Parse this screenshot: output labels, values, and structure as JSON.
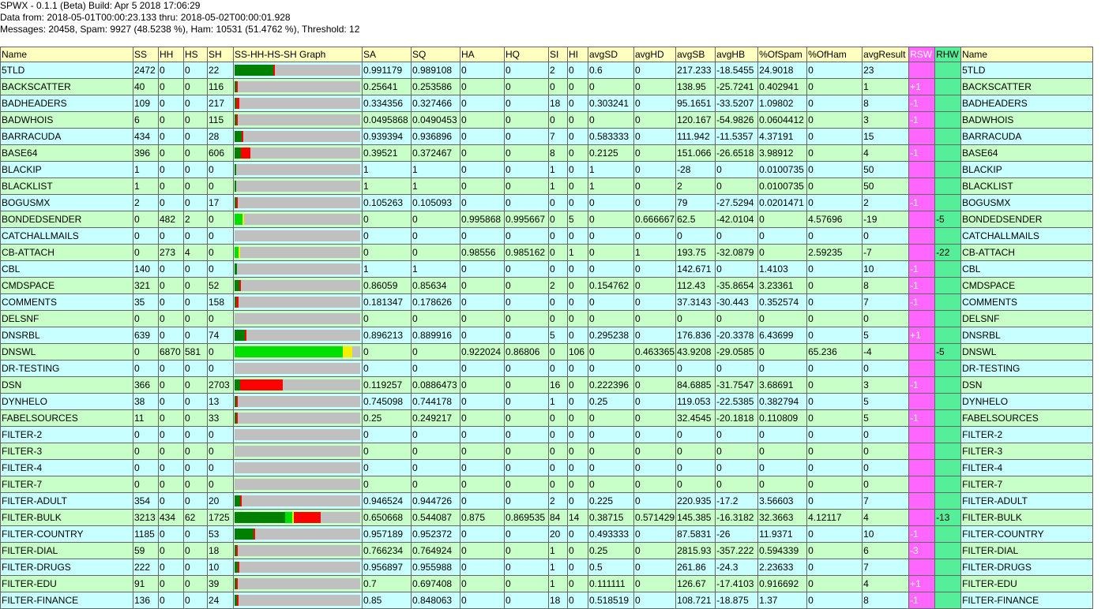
{
  "header": {
    "line1": "SPWX - 0.1.1 (Beta) Build: Apr 5 2018 17:06:29",
    "line2": "Data from: 2018-05-01T00:00:23.133 thru: 2018-05-02T00:00:01.928",
    "line3": "Messages: 20458, Spam: 9927 (48.5238 %), Ham: 10531 (51.4762 %), Threshold: 12"
  },
  "columns": [
    "Name",
    "SS",
    "HH",
    "HS",
    "SH",
    "SS-HH-HS-SH Graph",
    "SA",
    "SQ",
    "HA",
    "HQ",
    "SI",
    "HI",
    "avgSD",
    "avgHD",
    "avgSB",
    "avgHB",
    "%OfSpam",
    "%OfHam",
    "avgResult",
    "RSW",
    "RHW",
    "Name"
  ],
  "colors": {
    "ss": "#008000",
    "hh": "#00e000",
    "hs": "#f0f000",
    "sh": "#ff0000",
    "bar_bg": "#c0c0c0",
    "row_a": "#c8ffff",
    "row_b": "#c8ffc8",
    "rsw": "#ff66ff",
    "rhw": "#55ee99"
  },
  "graph_scale_total": 8000,
  "rows": [
    {
      "name": "5TLD",
      "ss": "2472",
      "hh": "0",
      "hs": "0",
      "sh": "22",
      "sa": "0.991179",
      "sq": "0.989108",
      "ha": "0",
      "hq": "0",
      "si": "2",
      "hi": "0",
      "avgsd": "0.6",
      "avghd": "0",
      "avgsb": "217.233",
      "avghb": "-18.5455",
      "pspam": "24.9018",
      "pham": "0",
      "avgres": "23",
      "rsw": "",
      "rhw": ""
    },
    {
      "name": "BACKSCATTER",
      "ss": "40",
      "hh": "0",
      "hs": "0",
      "sh": "116",
      "sa": "0.25641",
      "sq": "0.253586",
      "ha": "0",
      "hq": "0",
      "si": "0",
      "hi": "0",
      "avgsd": "0",
      "avghd": "0",
      "avgsb": "138.95",
      "avghb": "-25.7241",
      "pspam": "0.402941",
      "pham": "0",
      "avgres": "1",
      "rsw": "+1",
      "rhw": ""
    },
    {
      "name": "BADHEADERS",
      "ss": "109",
      "hh": "0",
      "hs": "0",
      "sh": "217",
      "sa": "0.334356",
      "sq": "0.327466",
      "ha": "0",
      "hq": "0",
      "si": "18",
      "hi": "0",
      "avgsd": "0.303241",
      "avghd": "0",
      "avgsb": "95.1651",
      "avghb": "-33.5207",
      "pspam": "1.09802",
      "pham": "0",
      "avgres": "8",
      "rsw": "-1",
      "rhw": ""
    },
    {
      "name": "BADWHOIS",
      "ss": "6",
      "hh": "0",
      "hs": "0",
      "sh": "115",
      "sa": "0.0495868",
      "sq": "0.0490453",
      "ha": "0",
      "hq": "0",
      "si": "0",
      "hi": "0",
      "avgsd": "0",
      "avghd": "0",
      "avgsb": "120.167",
      "avghb": "-54.9826",
      "pspam": "0.0604412",
      "pham": "0",
      "avgres": "3",
      "rsw": "-1",
      "rhw": ""
    },
    {
      "name": "BARRACUDA",
      "ss": "434",
      "hh": "0",
      "hs": "0",
      "sh": "28",
      "sa": "0.939394",
      "sq": "0.936896",
      "ha": "0",
      "hq": "0",
      "si": "7",
      "hi": "0",
      "avgsd": "0.583333",
      "avghd": "0",
      "avgsb": "111.942",
      "avghb": "-11.5357",
      "pspam": "4.37191",
      "pham": "0",
      "avgres": "15",
      "rsw": "",
      "rhw": ""
    },
    {
      "name": "BASE64",
      "ss": "396",
      "hh": "0",
      "hs": "0",
      "sh": "606",
      "sa": "0.39521",
      "sq": "0.372467",
      "ha": "0",
      "hq": "0",
      "si": "8",
      "hi": "0",
      "avgsd": "0.2125",
      "avghd": "0",
      "avgsb": "151.066",
      "avghb": "-26.6518",
      "pspam": "3.98912",
      "pham": "0",
      "avgres": "4",
      "rsw": "-1",
      "rhw": ""
    },
    {
      "name": "BLACKIP",
      "ss": "1",
      "hh": "0",
      "hs": "0",
      "sh": "0",
      "sa": "1",
      "sq": "1",
      "ha": "0",
      "hq": "0",
      "si": "1",
      "hi": "0",
      "avgsd": "1",
      "avghd": "0",
      "avgsb": "-28",
      "avghb": "0",
      "pspam": "0.0100735",
      "pham": "0",
      "avgres": "50",
      "rsw": "",
      "rhw": ""
    },
    {
      "name": "BLACKLIST",
      "ss": "1",
      "hh": "0",
      "hs": "0",
      "sh": "0",
      "sa": "1",
      "sq": "1",
      "ha": "0",
      "hq": "0",
      "si": "1",
      "hi": "0",
      "avgsd": "1",
      "avghd": "0",
      "avgsb": "2",
      "avghb": "0",
      "pspam": "0.0100735",
      "pham": "0",
      "avgres": "50",
      "rsw": "",
      "rhw": ""
    },
    {
      "name": "BOGUSMX",
      "ss": "2",
      "hh": "0",
      "hs": "0",
      "sh": "17",
      "sa": "0.105263",
      "sq": "0.105093",
      "ha": "0",
      "hq": "0",
      "si": "0",
      "hi": "0",
      "avgsd": "0",
      "avghd": "0",
      "avgsb": "79",
      "avghb": "-27.5294",
      "pspam": "0.0201471",
      "pham": "0",
      "avgres": "2",
      "rsw": "-1",
      "rhw": ""
    },
    {
      "name": "BONDEDSENDER",
      "ss": "0",
      "hh": "482",
      "hs": "2",
      "sh": "0",
      "sa": "0",
      "sq": "0",
      "ha": "0.995868",
      "hq": "0.995667",
      "si": "0",
      "hi": "5",
      "avgsd": "0",
      "avghd": "0.666667",
      "avgsb": "62.5",
      "avghb": "-42.0104",
      "pspam": "0",
      "pham": "4.57696",
      "avgres": "-19",
      "rsw": "",
      "rhw": "-5"
    },
    {
      "name": "CATCHALLMAILS",
      "ss": "0",
      "hh": "0",
      "hs": "0",
      "sh": "0",
      "sa": "0",
      "sq": "0",
      "ha": "0",
      "hq": "0",
      "si": "0",
      "hi": "0",
      "avgsd": "0",
      "avghd": "0",
      "avgsb": "0",
      "avghb": "0",
      "pspam": "0",
      "pham": "0",
      "avgres": "0",
      "rsw": "",
      "rhw": ""
    },
    {
      "name": "CB-ATTACH",
      "ss": "0",
      "hh": "273",
      "hs": "4",
      "sh": "0",
      "sa": "0",
      "sq": "0",
      "ha": "0.98556",
      "hq": "0.985162",
      "si": "0",
      "hi": "1",
      "avgsd": "0",
      "avghd": "1",
      "avgsb": "193.75",
      "avghb": "-32.0879",
      "pspam": "0",
      "pham": "2.59235",
      "avgres": "-7",
      "rsw": "",
      "rhw": "-22"
    },
    {
      "name": "CBL",
      "ss": "140",
      "hh": "0",
      "hs": "0",
      "sh": "0",
      "sa": "1",
      "sq": "1",
      "ha": "0",
      "hq": "0",
      "si": "0",
      "hi": "0",
      "avgsd": "0",
      "avghd": "0",
      "avgsb": "142.671",
      "avghb": "0",
      "pspam": "1.4103",
      "pham": "0",
      "avgres": "10",
      "rsw": "-1",
      "rhw": ""
    },
    {
      "name": "CMDSPACE",
      "ss": "321",
      "hh": "0",
      "hs": "0",
      "sh": "52",
      "sa": "0.86059",
      "sq": "0.85634",
      "ha": "0",
      "hq": "0",
      "si": "2",
      "hi": "0",
      "avgsd": "0.154762",
      "avghd": "0",
      "avgsb": "112.43",
      "avghb": "-35.8654",
      "pspam": "3.23361",
      "pham": "0",
      "avgres": "8",
      "rsw": "-1",
      "rhw": ""
    },
    {
      "name": "COMMENTS",
      "ss": "35",
      "hh": "0",
      "hs": "0",
      "sh": "158",
      "sa": "0.181347",
      "sq": "0.178626",
      "ha": "0",
      "hq": "0",
      "si": "0",
      "hi": "0",
      "avgsd": "0",
      "avghd": "0",
      "avgsb": "37.3143",
      "avghb": "-30.443",
      "pspam": "0.352574",
      "pham": "0",
      "avgres": "7",
      "rsw": "-1",
      "rhw": ""
    },
    {
      "name": "DELSNF",
      "ss": "0",
      "hh": "0",
      "hs": "0",
      "sh": "0",
      "sa": "0",
      "sq": "0",
      "ha": "0",
      "hq": "0",
      "si": "0",
      "hi": "0",
      "avgsd": "0",
      "avghd": "0",
      "avgsb": "0",
      "avghb": "0",
      "pspam": "0",
      "pham": "0",
      "avgres": "0",
      "rsw": "",
      "rhw": ""
    },
    {
      "name": "DNSRBL",
      "ss": "639",
      "hh": "0",
      "hs": "0",
      "sh": "74",
      "sa": "0.896213",
      "sq": "0.889916",
      "ha": "0",
      "hq": "0",
      "si": "5",
      "hi": "0",
      "avgsd": "0.295238",
      "avghd": "0",
      "avgsb": "176.836",
      "avghb": "-20.3378",
      "pspam": "6.43699",
      "pham": "0",
      "avgres": "5",
      "rsw": "+1",
      "rhw": ""
    },
    {
      "name": "DNSWL",
      "ss": "0",
      "hh": "6870",
      "hs": "581",
      "sh": "0",
      "sa": "0",
      "sq": "0",
      "ha": "0.922024",
      "hq": "0.86806",
      "si": "0",
      "hi": "106",
      "avgsd": "0",
      "avghd": "0.463365",
      "avgsb": "43.9208",
      "avghb": "-29.0585",
      "pspam": "0",
      "pham": "65.236",
      "avgres": "-4",
      "rsw": "",
      "rhw": "-5"
    },
    {
      "name": "DR-TESTING",
      "ss": "0",
      "hh": "0",
      "hs": "0",
      "sh": "0",
      "sa": "0",
      "sq": "0",
      "ha": "0",
      "hq": "0",
      "si": "0",
      "hi": "0",
      "avgsd": "0",
      "avghd": "0",
      "avgsb": "0",
      "avghb": "0",
      "pspam": "0",
      "pham": "0",
      "avgres": "0",
      "rsw": "",
      "rhw": ""
    },
    {
      "name": "DSN",
      "ss": "366",
      "hh": "0",
      "hs": "0",
      "sh": "2703",
      "sa": "0.119257",
      "sq": "0.0886473",
      "ha": "0",
      "hq": "0",
      "si": "16",
      "hi": "0",
      "avgsd": "0.222396",
      "avghd": "0",
      "avgsb": "84.6885",
      "avghb": "-31.7547",
      "pspam": "3.68691",
      "pham": "0",
      "avgres": "3",
      "rsw": "-1",
      "rhw": ""
    },
    {
      "name": "DYNHELO",
      "ss": "38",
      "hh": "0",
      "hs": "0",
      "sh": "13",
      "sa": "0.745098",
      "sq": "0.744178",
      "ha": "0",
      "hq": "0",
      "si": "1",
      "hi": "0",
      "avgsd": "0.25",
      "avghd": "0",
      "avgsb": "119.053",
      "avghb": "-22.5385",
      "pspam": "0.382794",
      "pham": "0",
      "avgres": "5",
      "rsw": "",
      "rhw": ""
    },
    {
      "name": "FABELSOURCES",
      "ss": "11",
      "hh": "0",
      "hs": "0",
      "sh": "33",
      "sa": "0.25",
      "sq": "0.249217",
      "ha": "0",
      "hq": "0",
      "si": "0",
      "hi": "0",
      "avgsd": "0",
      "avghd": "0",
      "avgsb": "32.4545",
      "avghb": "-20.1818",
      "pspam": "0.110809",
      "pham": "0",
      "avgres": "5",
      "rsw": "-1",
      "rhw": ""
    },
    {
      "name": "FILTER-2",
      "ss": "0",
      "hh": "0",
      "hs": "0",
      "sh": "0",
      "sa": "0",
      "sq": "0",
      "ha": "0",
      "hq": "0",
      "si": "0",
      "hi": "0",
      "avgsd": "0",
      "avghd": "0",
      "avgsb": "0",
      "avghb": "0",
      "pspam": "0",
      "pham": "0",
      "avgres": "0",
      "rsw": "",
      "rhw": ""
    },
    {
      "name": "FILTER-3",
      "ss": "0",
      "hh": "0",
      "hs": "0",
      "sh": "0",
      "sa": "0",
      "sq": "0",
      "ha": "0",
      "hq": "0",
      "si": "0",
      "hi": "0",
      "avgsd": "0",
      "avghd": "0",
      "avgsb": "0",
      "avghb": "0",
      "pspam": "0",
      "pham": "0",
      "avgres": "0",
      "rsw": "",
      "rhw": ""
    },
    {
      "name": "FILTER-4",
      "ss": "0",
      "hh": "0",
      "hs": "0",
      "sh": "0",
      "sa": "0",
      "sq": "0",
      "ha": "0",
      "hq": "0",
      "si": "0",
      "hi": "0",
      "avgsd": "0",
      "avghd": "0",
      "avgsb": "0",
      "avghb": "0",
      "pspam": "0",
      "pham": "0",
      "avgres": "0",
      "rsw": "",
      "rhw": ""
    },
    {
      "name": "FILTER-7",
      "ss": "0",
      "hh": "0",
      "hs": "0",
      "sh": "0",
      "sa": "0",
      "sq": "0",
      "ha": "0",
      "hq": "0",
      "si": "0",
      "hi": "0",
      "avgsd": "0",
      "avghd": "0",
      "avgsb": "0",
      "avghb": "0",
      "pspam": "0",
      "pham": "0",
      "avgres": "0",
      "rsw": "",
      "rhw": ""
    },
    {
      "name": "FILTER-ADULT",
      "ss": "354",
      "hh": "0",
      "hs": "0",
      "sh": "20",
      "sa": "0.946524",
      "sq": "0.944726",
      "ha": "0",
      "hq": "0",
      "si": "2",
      "hi": "0",
      "avgsd": "0.225",
      "avghd": "0",
      "avgsb": "220.935",
      "avghb": "-17.2",
      "pspam": "3.56603",
      "pham": "0",
      "avgres": "7",
      "rsw": "",
      "rhw": ""
    },
    {
      "name": "FILTER-BULK",
      "ss": "3213",
      "hh": "434",
      "hs": "62",
      "sh": "1725",
      "sa": "0.650668",
      "sq": "0.544087",
      "ha": "0.875",
      "hq": "0.869535",
      "si": "84",
      "hi": "14",
      "avgsd": "0.38715",
      "avghd": "0.571429",
      "avgsb": "145.385",
      "avghb": "-16.3182",
      "pspam": "32.3663",
      "pham": "4.12117",
      "avgres": "4",
      "rsw": "",
      "rhw": "-13"
    },
    {
      "name": "FILTER-COUNTRY",
      "ss": "1185",
      "hh": "0",
      "hs": "0",
      "sh": "53",
      "sa": "0.957189",
      "sq": "0.952372",
      "ha": "0",
      "hq": "0",
      "si": "20",
      "hi": "0",
      "avgsd": "0.493333",
      "avghd": "0",
      "avgsb": "87.5831",
      "avghb": "-26",
      "pspam": "11.9371",
      "pham": "0",
      "avgres": "10",
      "rsw": "-1",
      "rhw": ""
    },
    {
      "name": "FILTER-DIAL",
      "ss": "59",
      "hh": "0",
      "hs": "0",
      "sh": "18",
      "sa": "0.766234",
      "sq": "0.764924",
      "ha": "0",
      "hq": "0",
      "si": "1",
      "hi": "0",
      "avgsd": "0.25",
      "avghd": "0",
      "avgsb": "2815.93",
      "avghb": "-357.222",
      "pspam": "0.594339",
      "pham": "0",
      "avgres": "6",
      "rsw": "-3",
      "rhw": ""
    },
    {
      "name": "FILTER-DRUGS",
      "ss": "222",
      "hh": "0",
      "hs": "0",
      "sh": "10",
      "sa": "0.956897",
      "sq": "0.955988",
      "ha": "0",
      "hq": "0",
      "si": "1",
      "hi": "0",
      "avgsd": "0.5",
      "avghd": "0",
      "avgsb": "261.86",
      "avghb": "-24.3",
      "pspam": "2.23633",
      "pham": "0",
      "avgres": "7",
      "rsw": "",
      "rhw": ""
    },
    {
      "name": "FILTER-EDU",
      "ss": "91",
      "hh": "0",
      "hs": "0",
      "sh": "39",
      "sa": "0.7",
      "sq": "0.697408",
      "ha": "0",
      "hq": "0",
      "si": "1",
      "hi": "0",
      "avgsd": "0.111111",
      "avghd": "0",
      "avgsb": "126.67",
      "avghb": "-17.4103",
      "pspam": "0.916692",
      "pham": "0",
      "avgres": "4",
      "rsw": "+1",
      "rhw": ""
    },
    {
      "name": "FILTER-FINANCE",
      "ss": "136",
      "hh": "0",
      "hs": "0",
      "sh": "24",
      "sa": "0.85",
      "sq": "0.848063",
      "ha": "0",
      "hq": "0",
      "si": "18",
      "hi": "0",
      "avgsd": "0.518519",
      "avghd": "0",
      "avgsb": "108.721",
      "avghb": "-18.875",
      "pspam": "1.37",
      "pham": "0",
      "avgres": "8",
      "rsw": "-1",
      "rhw": ""
    }
  ]
}
